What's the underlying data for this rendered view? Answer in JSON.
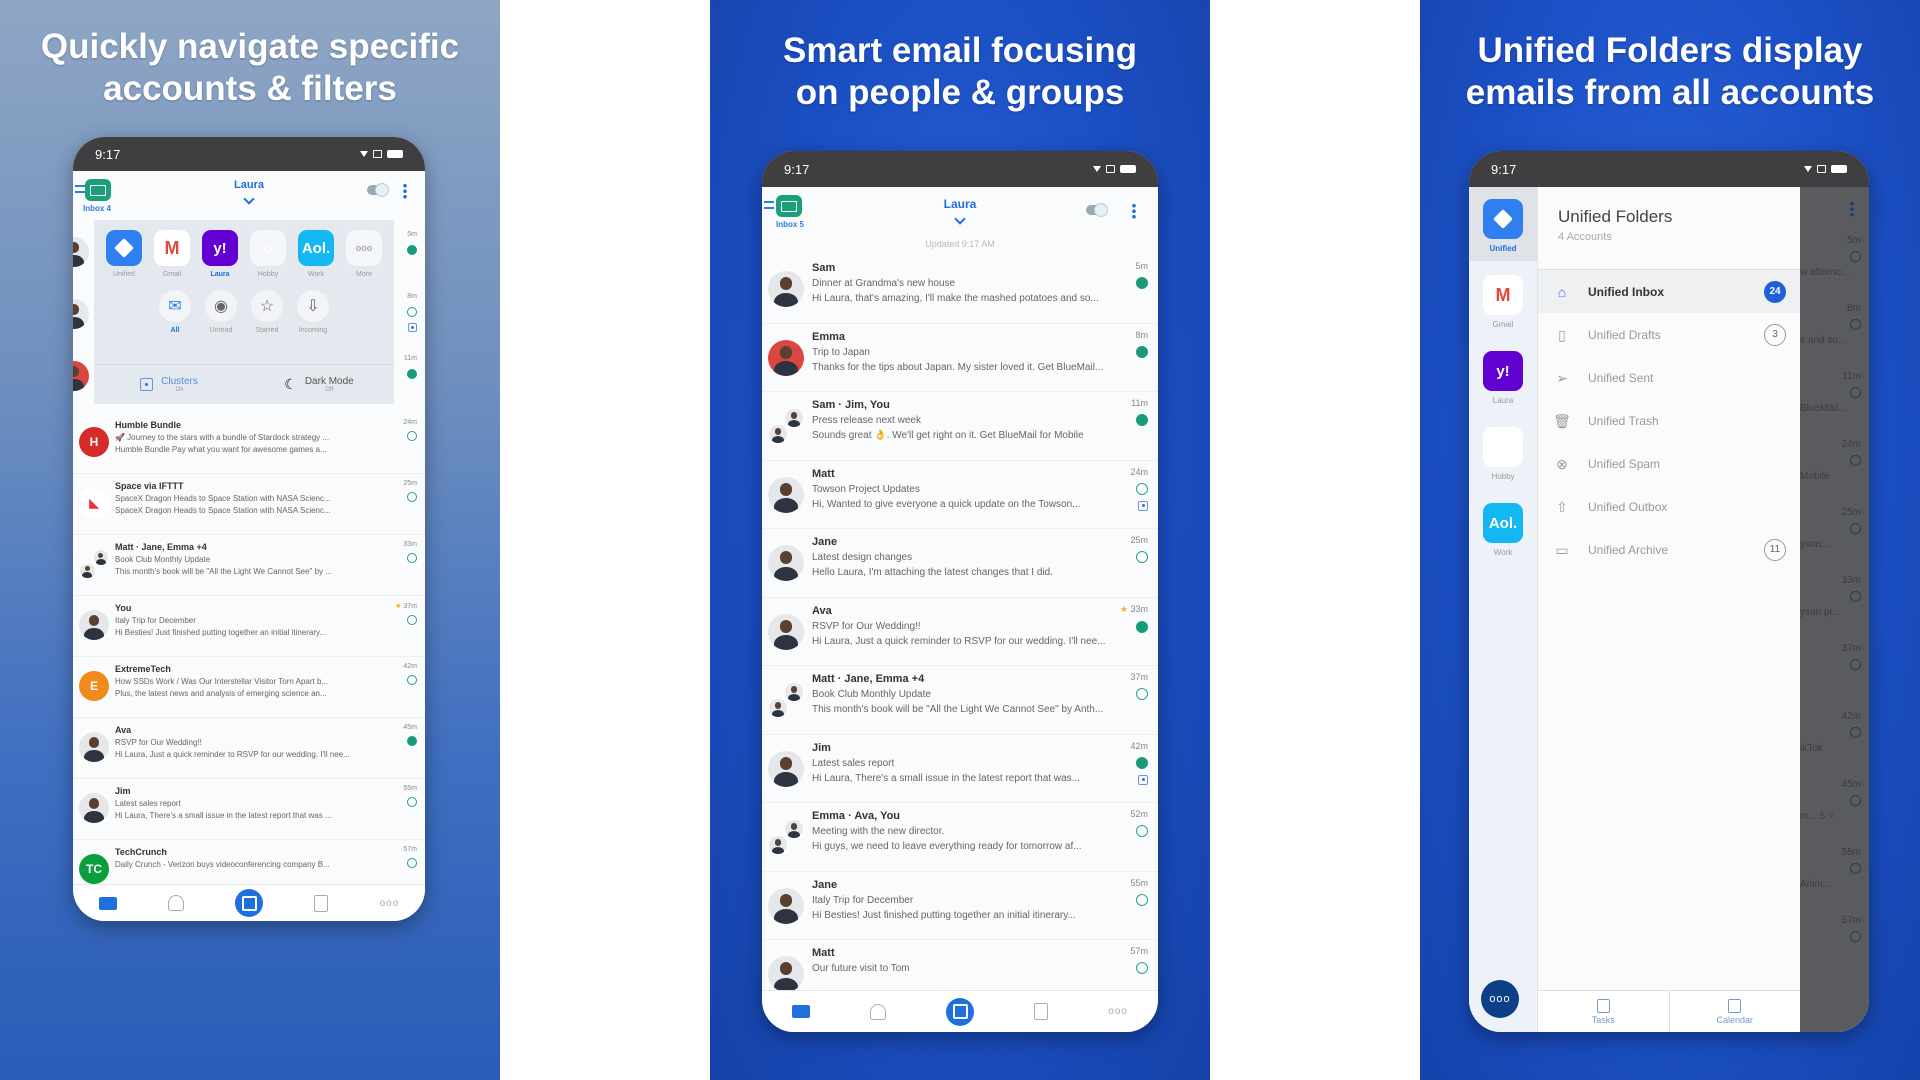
{
  "panels": [
    {
      "headline_line1": "Quickly navigate specific",
      "headline_line2": "accounts & filters"
    },
    {
      "headline_line1": "Smart email focusing",
      "headline_line2": "on people & groups"
    },
    {
      "headline_line1": "Unified Folders display",
      "headline_line2": "emails from all accounts"
    }
  ],
  "status_time": "9:17",
  "header": {
    "account": "Laura",
    "inbox_label_left": "Inbox 4",
    "inbox_label_mid": "Inbox 5",
    "updated": "Updated 9:17 AM"
  },
  "colors": {
    "accent": "#1f6fe0",
    "unread": "#1a9a7d",
    "brand_green": "#1aa07a",
    "badge": "#1f5fd8"
  },
  "switcher": {
    "accounts": [
      {
        "label": "Unified",
        "icon": "cube-icon",
        "logo": "",
        "bg": "#2f7ff0",
        "selected": false
      },
      {
        "label": "Gmail",
        "icon": "gmail-icon",
        "logo": "M",
        "bg": "#ffffff",
        "selected": false
      },
      {
        "label": "Laura",
        "icon": "yahoo-icon",
        "logo": "y!",
        "bg": "#6001d2",
        "selected": true
      },
      {
        "label": "Hobby",
        "icon": "outlook-icon",
        "logo": "o",
        "bg": "#f4f6f9",
        "selected": false
      },
      {
        "label": "Work",
        "icon": "aol-icon",
        "logo": "Aol.",
        "bg": "#13b8f2",
        "selected": false
      },
      {
        "label": "More",
        "icon": "more-icon",
        "logo": "ooo",
        "bg": "#f4f6f9",
        "selected": false
      }
    ],
    "filters": [
      {
        "label": "All",
        "icon": "envelope-icon",
        "glyph": "✉",
        "selected": true
      },
      {
        "label": "Unread",
        "icon": "unread-dot-icon",
        "glyph": "◉",
        "selected": false
      },
      {
        "label": "Starred",
        "icon": "star-icon",
        "glyph": "☆",
        "selected": false
      },
      {
        "label": "Incoming",
        "icon": "incoming-tray-icon",
        "glyph": "⇩",
        "selected": false
      }
    ],
    "clusters": {
      "label": "Clusters",
      "state": "On"
    },
    "dark_mode": {
      "label": "Dark Mode",
      "state": "Off"
    }
  },
  "left_list_behind": [
    {
      "time": "5m",
      "status": "unread"
    },
    {
      "time": "8m",
      "status": "read",
      "cluster": true
    },
    {
      "time": "11m",
      "status": "unread"
    }
  ],
  "left_list": [
    {
      "from": "Humble Bundle",
      "subject": "🚀 Journey to the stars with a bundle of Stardock strategy ...",
      "preview": "Humble Bundle Pay what you want for awesome games a...",
      "time": "24m",
      "status": "read",
      "avatar": "brand",
      "avatar_logo": "H",
      "avatar_color": "#d52b2b"
    },
    {
      "from": "Space via IFTTT",
      "subject": "SpaceX Dragon Heads to Space Station with NASA Scienc...",
      "preview": "SpaceX Dragon Heads to Space Station with NASA Scienc...",
      "time": "25m",
      "status": "read",
      "avatar": "brand",
      "avatar_logo": "◣",
      "avatar_color": "#ffffff"
    },
    {
      "from": "Matt · Jane, Emma +4",
      "subject": "Book Club Monthly Update",
      "preview": "This month's book will be \"All the Light We Cannot See\" by ...",
      "time": "33m",
      "status": "read",
      "avatar": "group"
    },
    {
      "from": "You",
      "subject": "Italy Trip for December",
      "preview": "Hi Besties! Just finished putting together an initial itinerary...",
      "time": "37m",
      "status": "read",
      "starred": true,
      "avatar": "person"
    },
    {
      "from": "ExtremeTech",
      "subject": "How SSDs Work / Was Our Interstellar Visitor Torn Apart b...",
      "preview": "Plus, the latest news and analysis of emerging science an...",
      "time": "42m",
      "status": "read",
      "avatar": "brand",
      "avatar_logo": "E",
      "avatar_color": "#f08a1c"
    },
    {
      "from": "Ava",
      "subject": "RSVP for Our Wedding!!",
      "preview": "Hi Laura, Just a quick reminder to RSVP for our wedding. I'll nee...",
      "time": "45m",
      "status": "unread",
      "avatar": "person"
    },
    {
      "from": "Jim",
      "subject": "Latest sales report",
      "preview": "Hi Laura, There's a small issue in the latest report that was ...",
      "time": "55m",
      "status": "read",
      "avatar": "person"
    },
    {
      "from": "TechCrunch",
      "subject": "Daily Crunch - Verizon buys videoconferencing company B...",
      "preview": "",
      "time": "57m",
      "status": "read",
      "avatar": "brand",
      "avatar_logo": "TC",
      "avatar_color": "#0a9e3c"
    }
  ],
  "mid_list": [
    {
      "from": "Sam",
      "subject": "Dinner at Grandma's new house",
      "preview": "Hi Laura, that's amazing, I'll make the mashed potatoes and so...",
      "time": "5m",
      "status": "unread",
      "avatar": "person"
    },
    {
      "from": "Emma",
      "subject": "Trip to Japan",
      "preview": "Thanks for the tips about Japan. My sister loved it. Get BlueMail...",
      "time": "8m",
      "status": "unread",
      "avatar": "red"
    },
    {
      "from": "Sam · Jim, You",
      "subject": "Press release next week",
      "preview": "Sounds great 👌. We'll get right on it. Get BlueMail for Mobile",
      "time": "11m",
      "status": "unread",
      "avatar": "group"
    },
    {
      "from": "Matt",
      "subject": "Towson Project Updates",
      "preview": "Hi, Wanted to give everyone a quick update on the Towson...",
      "time": "24m",
      "status": "read",
      "cluster": true,
      "avatar": "person"
    },
    {
      "from": "Jane",
      "subject": "Latest design changes",
      "preview": "Hello Laura, I'm attaching the latest changes that I did.",
      "time": "25m",
      "status": "read",
      "avatar": "person"
    },
    {
      "from": "Ava",
      "subject": "RSVP for Our Wedding!!",
      "preview": "Hi Laura, Just a quick reminder to RSVP for our wedding. I'll nee...",
      "time": "33m",
      "status": "unread",
      "starred": true,
      "avatar": "person"
    },
    {
      "from": "Matt · Jane, Emma +4",
      "subject": "Book Club Monthly Update",
      "preview": "This month's book will be \"All the Light We Cannot See\" by Anth...",
      "time": "37m",
      "status": "read",
      "avatar": "group"
    },
    {
      "from": "Jim",
      "subject": "Latest sales report",
      "preview": "Hi Laura, There's a small issue in the latest report that was...",
      "time": "42m",
      "status": "unread",
      "cluster": true,
      "avatar": "person"
    },
    {
      "from": "Emma · Ava, You",
      "subject": "Meeting with the new director.",
      "preview": "Hi guys, we need to leave everything ready for tomorrow af...",
      "time": "52m",
      "status": "read",
      "avatar": "group"
    },
    {
      "from": "Jane",
      "subject": "Italy Trip for December",
      "preview": "Hi Besties! Just finished putting together an initial itinerary...",
      "time": "55m",
      "status": "read",
      "avatar": "person"
    },
    {
      "from": "Matt",
      "subject": "Our future visit to Tom",
      "preview": "",
      "time": "57m",
      "status": "read",
      "avatar": "person"
    }
  ],
  "unified": {
    "title": "Unified Folders",
    "subtitle": "4 Accounts",
    "sidebar_accounts": [
      {
        "label": "Unified",
        "icon": "cube-icon",
        "logo": "",
        "bg": "#2f7ff0",
        "selected": true
      },
      {
        "label": "Gmail",
        "icon": "gmail-icon",
        "logo": "M",
        "bg": "#ffffff",
        "selected": false
      },
      {
        "label": "Laura",
        "icon": "yahoo-icon",
        "logo": "y!",
        "bg": "#6001d2",
        "selected": false
      },
      {
        "label": "Hobby",
        "icon": "outlook-icon",
        "logo": "o",
        "bg": "#ffffff",
        "selected": false
      },
      {
        "label": "Work",
        "icon": "aol-icon",
        "logo": "Aol.",
        "bg": "#13b8f2",
        "selected": false
      }
    ],
    "folders": [
      {
        "label": "Unified Inbox",
        "icon": "inbox-tray-icon",
        "glyph": "⌂",
        "count": "24",
        "selected": true
      },
      {
        "label": "Unified Drafts",
        "icon": "draft-page-icon",
        "glyph": "▯",
        "count": "3"
      },
      {
        "label": "Unified Sent",
        "icon": "paper-plane-icon",
        "glyph": "➢",
        "count": ""
      },
      {
        "label": "Unified Trash",
        "icon": "trash-icon",
        "glyph": "🗑",
        "count": ""
      },
      {
        "label": "Unified Spam",
        "icon": "spam-x-icon",
        "glyph": "⊗",
        "count": ""
      },
      {
        "label": "Unified Outbox",
        "icon": "outbox-tray-icon",
        "glyph": "⇧",
        "count": ""
      },
      {
        "label": "Unified Archive",
        "icon": "folder-icon",
        "glyph": "▭",
        "count": "11"
      }
    ],
    "tabs": [
      {
        "label": "Tasks",
        "icon": "clipboard-icon"
      },
      {
        "label": "Calendar",
        "icon": "calendar-icon"
      }
    ],
    "more_label": "ooo",
    "behind_times": [
      "5m",
      "8m",
      "11m",
      "24m",
      "25m",
      "33m",
      "37m",
      "42m",
      "45m",
      "55m",
      "57m"
    ],
    "behind_snippets": [
      "w afterno...",
      "s and so...",
      "BlueMail...",
      "Mobile",
      "yson...",
      "yson pr...",
      "",
      "ikTok",
      "m... 5 >",
      "Anim...",
      ""
    ]
  },
  "bottom_nav": [
    {
      "name": "inbox",
      "icon": "inbox-icon"
    },
    {
      "name": "people",
      "icon": "people-icon"
    },
    {
      "name": "compose",
      "icon": "compose-icon"
    },
    {
      "name": "tasks",
      "icon": "clipboard-icon"
    },
    {
      "name": "more",
      "icon": "more-icon",
      "label": "ooo"
    }
  ]
}
